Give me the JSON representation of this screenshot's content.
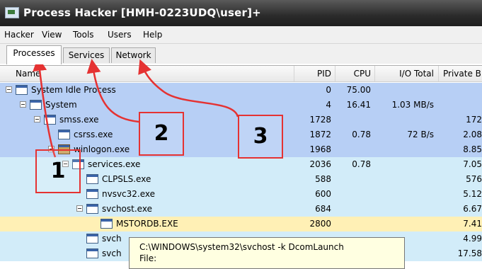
{
  "window": {
    "title": "Process Hacker [HMH-0223UDQ\\user]+"
  },
  "menu": [
    "Hacker",
    "View",
    "Tools",
    "Users",
    "Help"
  ],
  "tabs": [
    {
      "label": "Processes",
      "active": true
    },
    {
      "label": "Services",
      "active": false
    },
    {
      "label": "Network",
      "active": false
    }
  ],
  "columns": {
    "name": "Name",
    "pid": "PID",
    "cpu": "CPU",
    "io": "I/O Total",
    "private": "Private B"
  },
  "rows": [
    {
      "name": "System Idle Process",
      "pid": "0",
      "cpu": "75.00",
      "io": "",
      "private": "",
      "level": 0,
      "expander": true,
      "bg": "#b7cff5"
    },
    {
      "name": "System",
      "pid": "4",
      "cpu": "16.41",
      "io": "1.03 MB/s",
      "private": "",
      "level": 1,
      "expander": true,
      "bg": "#b7cff5"
    },
    {
      "name": "smss.exe",
      "pid": "1728",
      "cpu": "",
      "io": "",
      "private": "172",
      "level": 2,
      "expander": true,
      "bg": "#b7cff5"
    },
    {
      "name": "csrss.exe",
      "pid": "1872",
      "cpu": "0.78",
      "io": "72 B/s",
      "private": "2.08",
      "level": 3,
      "expander": false,
      "bg": "#b7cff5"
    },
    {
      "name": "winlogon.exe",
      "pid": "1968",
      "cpu": "",
      "io": "",
      "private": "8.85",
      "level": 3,
      "expander": true,
      "bg": "#b7cff5",
      "icon": "winlogon"
    },
    {
      "name": "services.exe",
      "pid": "2036",
      "cpu": "0.78",
      "io": "",
      "private": "7.05",
      "level": 4,
      "expander": true,
      "bg": "#d2ecf9"
    },
    {
      "name": "CLPSLS.exe",
      "pid": "588",
      "cpu": "",
      "io": "",
      "private": "576",
      "level": 5,
      "expander": false,
      "bg": "#d2ecf9"
    },
    {
      "name": "nvsvc32.exe",
      "pid": "600",
      "cpu": "",
      "io": "",
      "private": "5.12",
      "level": 5,
      "expander": false,
      "bg": "#d2ecf9"
    },
    {
      "name": "svchost.exe",
      "pid": "684",
      "cpu": "",
      "io": "",
      "private": "6.67",
      "level": 5,
      "expander": true,
      "bg": "#d2ecf9"
    },
    {
      "name": "MSTORDB.EXE",
      "pid": "2800",
      "cpu": "",
      "io": "",
      "private": "7.41",
      "level": 6,
      "expander": false,
      "bg": "#fff0b5"
    },
    {
      "name": "svch",
      "pid": "",
      "cpu": "",
      "io": "",
      "private": "4.99",
      "level": 5,
      "expander": false,
      "bg": "#d2ecf9"
    },
    {
      "name": "svch",
      "pid": "",
      "cpu": "",
      "io": "",
      "private": "17.58",
      "level": 5,
      "expander": false,
      "bg": "#d2ecf9"
    }
  ],
  "tooltip": {
    "line1": "C:\\WINDOWS\\system32\\svchost -k DcomLaunch",
    "line2": "File:"
  },
  "annotations": [
    "1",
    "2",
    "3"
  ],
  "colors": {
    "annotation": "#e53232",
    "system_rows": "#b7cff5",
    "service_rows": "#d2ecf9",
    "highlight_row": "#fff0b5"
  }
}
